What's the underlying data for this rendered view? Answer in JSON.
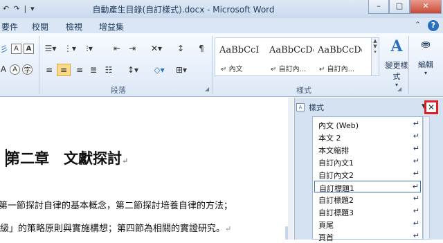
{
  "window": {
    "title": "自動產生目錄(自訂樣式).docx - Microsoft Word",
    "minimize": "–",
    "maximize": "□",
    "close": "✕"
  },
  "qat": [
    "↶",
    "↷",
    "|",
    "▾"
  ],
  "tabs": [
    "要件",
    "校閱",
    "檢視",
    "增益集"
  ],
  "ribbon": {
    "paragraph_group": "段落",
    "styles_group": "樣式",
    "styles_gallery": [
      {
        "preview": "AaBbCcI",
        "name": "內文"
      },
      {
        "preview": "AaBbCcDd",
        "name": "自訂內..."
      },
      {
        "preview": "AaBbCcDd",
        "name": "自訂內..."
      }
    ],
    "change_styles": "變更樣式",
    "edit": "編輯"
  },
  "document": {
    "heading": "第二章　文獻探討",
    "para1": "第一節探討自律的基本概念，第二節探討培養自律的方法；",
    "para2": "級」的策略原則與實施構想；第四節為相關的實證研究。"
  },
  "styles_pane": {
    "title": "樣式",
    "close": "✕",
    "items": [
      {
        "label": "內文 (Web)"
      },
      {
        "label": "本文 2"
      },
      {
        "label": "本文縮排"
      },
      {
        "label": "自訂內文1"
      },
      {
        "label": "自訂內文2"
      },
      {
        "label": "自訂標題1"
      },
      {
        "label": "自訂標題2"
      },
      {
        "label": "自訂標題3"
      },
      {
        "label": "頁尾"
      },
      {
        "label": "頁首"
      }
    ],
    "selected_index": 5
  }
}
